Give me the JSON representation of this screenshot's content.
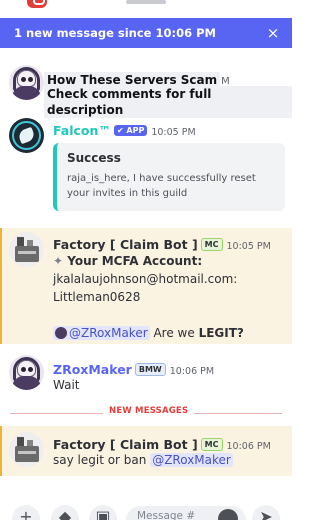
{
  "banner": {
    "text": "1 new message since 10:06 PM",
    "close_icon": "×"
  },
  "messages": [
    {
      "id": "m1",
      "line1": "How These Servers Scam",
      "line1_suffix": "M",
      "line2": "Check comments for full description"
    },
    {
      "id": "m2",
      "username": "Falcon™",
      "tag": "✔ APP",
      "time": "10:05 PM",
      "embed": {
        "title": "Success",
        "description": "raja_is_here, I have successfully reset your invites in this guild"
      }
    },
    {
      "id": "m3",
      "username": "Factory [ Claim Bot ]",
      "tag": "MC",
      "time": "10:05 PM",
      "heading": "Your MCFA Account:",
      "line1": "jkalalaujohnson@hotmail.com:",
      "line2": "Littleman0628",
      "mention": "@ZRoxMaker",
      "after_mention": "Are we",
      "emphasis": "LEGIT?"
    },
    {
      "id": "m4",
      "username": "ZRoxMaker",
      "tag": "BMW",
      "time": "10:06 PM",
      "text": "Wait"
    },
    {
      "id": "m5",
      "username": "Factory [ Claim Bot ]",
      "tag": "MC",
      "time": "10:06 PM",
      "text": "say legit or ban",
      "mention": "@ZRoxMaker"
    }
  ],
  "divider": {
    "label": "NEW MESSAGES"
  },
  "composer": {
    "placeholder": "Message #"
  },
  "colors": {
    "accent": "#5865f2",
    "falcon": "#20c8ba",
    "new_messages": "#e23d3d",
    "highlight": "#fbf3e2"
  }
}
